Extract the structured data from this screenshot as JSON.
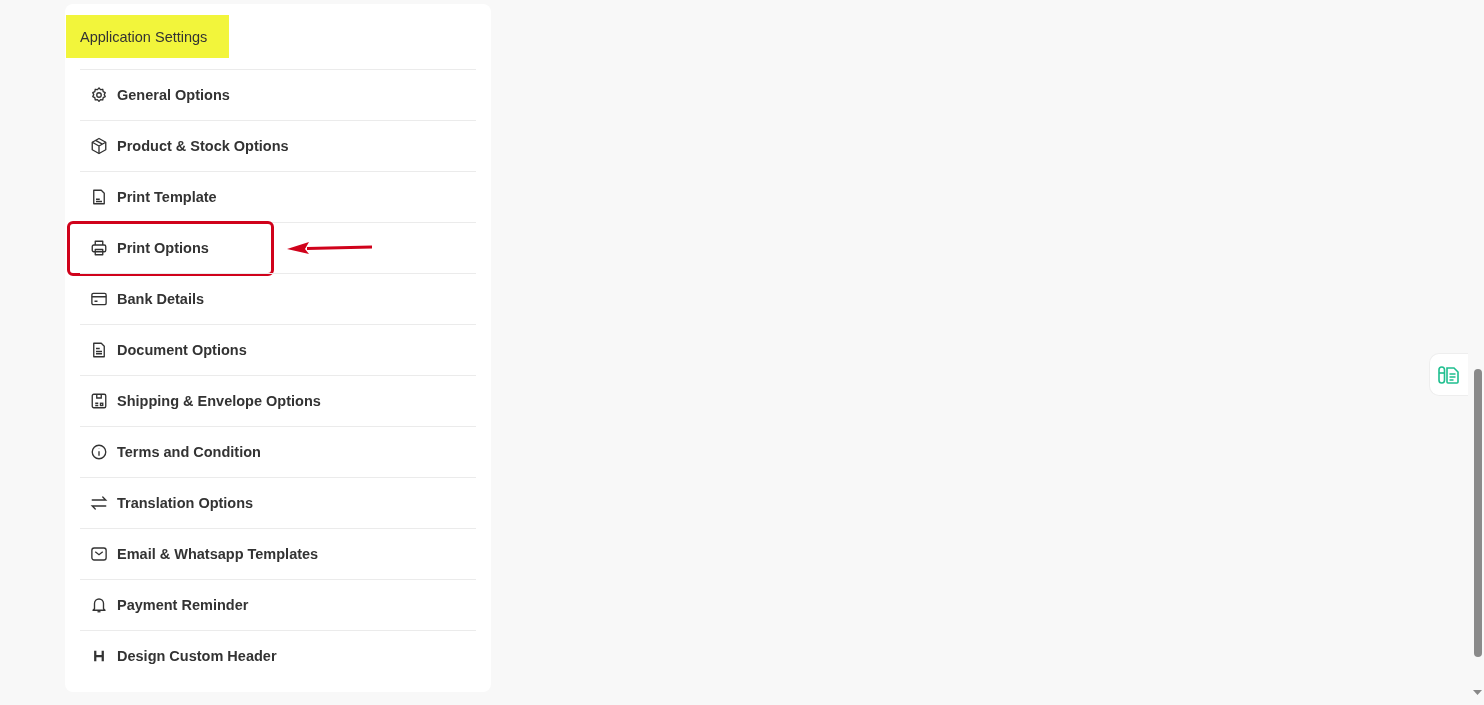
{
  "settings_card": {
    "title": "Application Settings",
    "title_highlighted": true,
    "items": [
      {
        "label": "General Options",
        "highlighted": false
      },
      {
        "label": "Product & Stock Options",
        "highlighted": false
      },
      {
        "label": "Print Template",
        "highlighted": false
      },
      {
        "label": "Print Options",
        "highlighted": true
      },
      {
        "label": "Bank Details",
        "highlighted": false
      },
      {
        "label": "Document Options",
        "highlighted": false
      },
      {
        "label": "Shipping & Envelope Options",
        "highlighted": false
      },
      {
        "label": "Terms and Condition",
        "highlighted": false
      },
      {
        "label": "Translation Options",
        "highlighted": false
      },
      {
        "label": "Email & Whatsapp Templates",
        "highlighted": false
      },
      {
        "label": "Payment Reminder",
        "highlighted": false
      },
      {
        "label": "Design Custom Header",
        "highlighted": false
      }
    ]
  }
}
